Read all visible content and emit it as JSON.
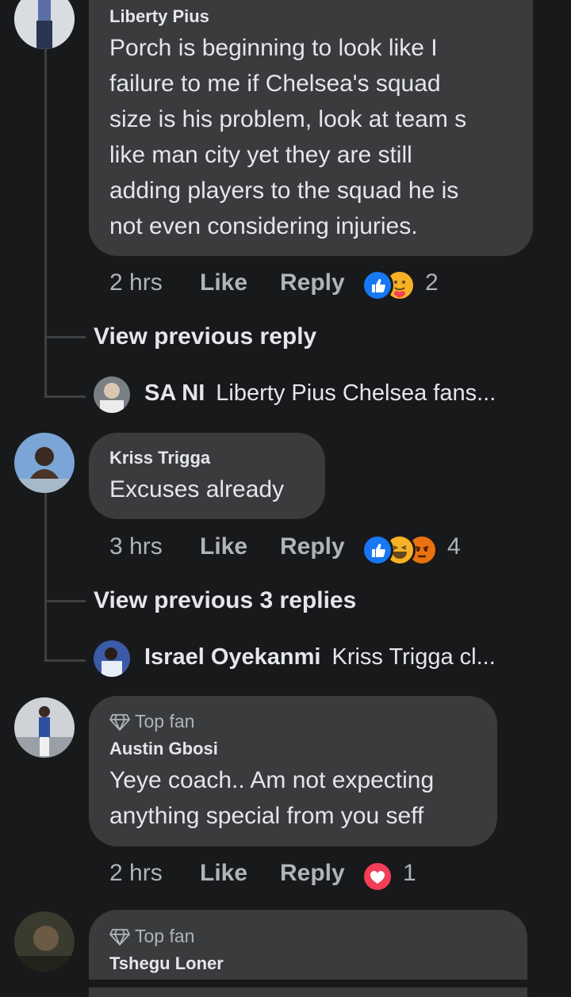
{
  "comments": [
    {
      "author": "Liberty Pius",
      "text_lines": [
        "Porch is beginning to look like I",
        "failure to me if Chelsea's squad",
        "size is his problem, look at team s",
        "like man city yet they are still",
        "adding players to the squad he is",
        "not even considering injuries."
      ],
      "time": "2 hrs",
      "like_label": "Like",
      "reply_label": "Reply",
      "reaction_count": "2",
      "reactions": [
        "like-icon",
        "care-icon"
      ],
      "view_replies": "View previous reply",
      "latest_reply": {
        "author": "SA NI",
        "text": "Liberty Pius Chelsea fans..."
      }
    },
    {
      "author": "Kriss Trigga",
      "text_lines": [
        "Excuses already"
      ],
      "time": "3 hrs",
      "like_label": "Like",
      "reply_label": "Reply",
      "reaction_count": "4",
      "reactions": [
        "like-icon",
        "haha-icon",
        "angry-icon"
      ],
      "view_replies": "View previous 3 replies",
      "latest_reply": {
        "author": "Israel Oyekanmi",
        "text": "Kriss Trigga cl..."
      }
    },
    {
      "badge": "Top fan",
      "author": "Austin Gbosi",
      "text_lines": [
        "Yeye coach.. Am not expecting",
        "anything special from you seff"
      ],
      "time": "2 hrs",
      "like_label": "Like",
      "reply_label": "Reply",
      "reaction_count": "1",
      "reactions": [
        "love-icon"
      ]
    },
    {
      "badge": "Top fan",
      "author": "Tshegu Loner"
    }
  ],
  "colors": {
    "background": "#18191a",
    "bubble": "#3a3b3c",
    "like_blue": "#1877f2",
    "love_red": "#f33e58",
    "haha_yellow": "#f7b125",
    "angry_orange": "#e9710f"
  }
}
